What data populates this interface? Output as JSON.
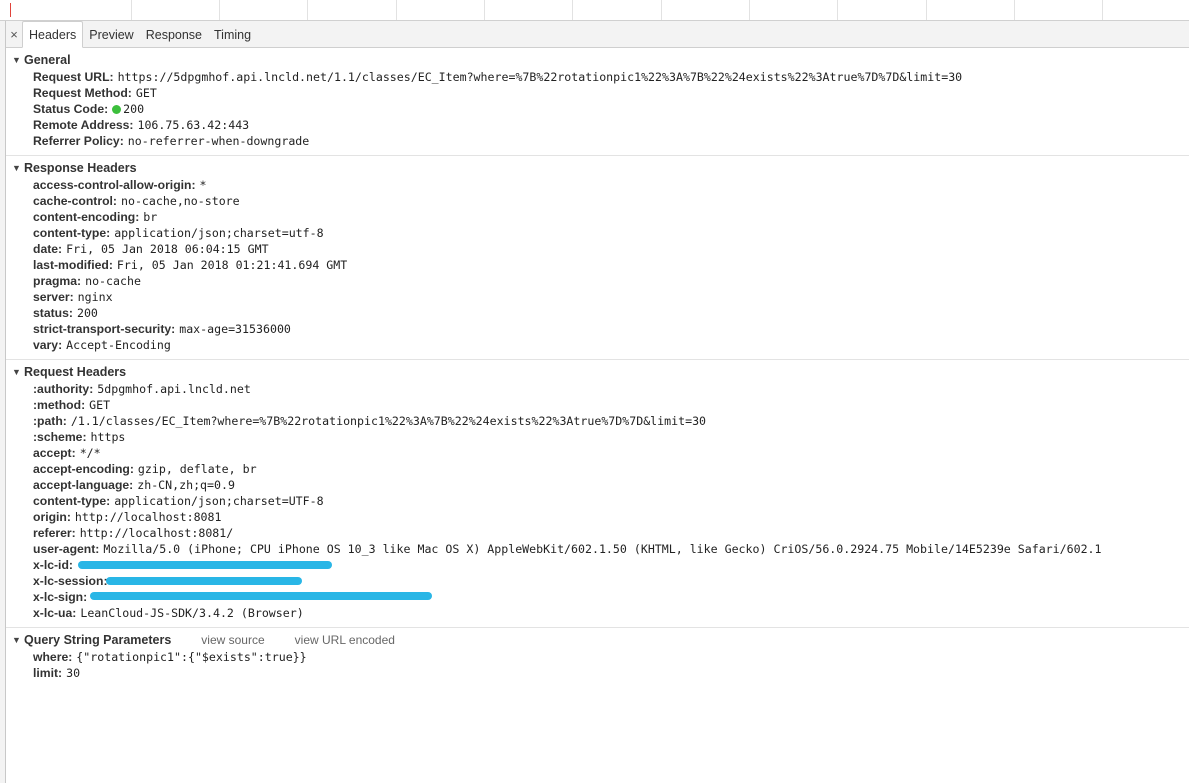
{
  "tabs": [
    "Headers",
    "Preview",
    "Response",
    "Timing"
  ],
  "close_label": "×",
  "general": {
    "title": "General",
    "rows": [
      {
        "key": "Request URL:",
        "value": "https://5dpgmhof.api.lncld.net/1.1/classes/EC_Item?where=%7B%22rotationpic1%22%3A%7B%22%24exists%22%3Atrue%7D%7D&limit=30"
      },
      {
        "key": "Request Method:",
        "value": "GET"
      },
      {
        "key": "Status Code:",
        "value": "200",
        "status_color": "#3cbf3c"
      },
      {
        "key": "Remote Address:",
        "value": "106.75.63.42:443"
      },
      {
        "key": "Referrer Policy:",
        "value": "no-referrer-when-downgrade"
      }
    ]
  },
  "response_headers": {
    "title": "Response Headers",
    "rows": [
      {
        "key": "access-control-allow-origin:",
        "value": "*"
      },
      {
        "key": "cache-control:",
        "value": "no-cache,no-store"
      },
      {
        "key": "content-encoding:",
        "value": "br"
      },
      {
        "key": "content-type:",
        "value": "application/json;charset=utf-8"
      },
      {
        "key": "date:",
        "value": "Fri, 05 Jan 2018 06:04:15 GMT"
      },
      {
        "key": "last-modified:",
        "value": "Fri, 05 Jan 2018 01:21:41.694 GMT"
      },
      {
        "key": "pragma:",
        "value": "no-cache"
      },
      {
        "key": "server:",
        "value": "nginx"
      },
      {
        "key": "status:",
        "value": "200"
      },
      {
        "key": "strict-transport-security:",
        "value": "max-age=31536000"
      },
      {
        "key": "vary:",
        "value": "Accept-Encoding"
      }
    ]
  },
  "request_headers": {
    "title": "Request Headers",
    "rows": [
      {
        "key": ":authority:",
        "value": "5dpgmhof.api.lncld.net"
      },
      {
        "key": ":method:",
        "value": "GET"
      },
      {
        "key": ":path:",
        "value": "/1.1/classes/EC_Item?where=%7B%22rotationpic1%22%3A%7B%22%24exists%22%3Atrue%7D%7D&limit=30"
      },
      {
        "key": ":scheme:",
        "value": "https"
      },
      {
        "key": "accept:",
        "value": "*/*"
      },
      {
        "key": "accept-encoding:",
        "value": "gzip, deflate, br"
      },
      {
        "key": "accept-language:",
        "value": "zh-CN,zh;q=0.9"
      },
      {
        "key": "content-type:",
        "value": "application/json;charset=UTF-8"
      },
      {
        "key": "origin:",
        "value": "http://localhost:8081"
      },
      {
        "key": "referer:",
        "value": "http://localhost:8081/"
      },
      {
        "key": "user-agent:",
        "value": "Mozilla/5.0 (iPhone; CPU iPhone OS 10_3 like Mac OS X) AppleWebKit/602.1.50 (KHTML, like Gecko) CriOS/56.0.2924.75 Mobile/14E5239e Safari/602.1"
      },
      {
        "key": "x-lc-id:",
        "value": "",
        "redacted": true
      },
      {
        "key": "x-lc-session:",
        "value": "",
        "redacted": true
      },
      {
        "key": "x-lc-sign:",
        "value": "",
        "redacted": true
      },
      {
        "key": "x-lc-ua:",
        "value": "LeanCloud-JS-SDK/3.4.2 (Browser)"
      }
    ]
  },
  "query_params": {
    "title": "Query String Parameters",
    "view_source": "view source",
    "view_url_encoded": "view URL encoded",
    "rows": [
      {
        "key": "where:",
        "value": "{\"rotationpic1\":{\"$exists\":true}}"
      },
      {
        "key": "limit:",
        "value": "30"
      }
    ]
  },
  "colors": {
    "redaction": "#29b6e6",
    "status_ok": "#3cbf3c"
  }
}
